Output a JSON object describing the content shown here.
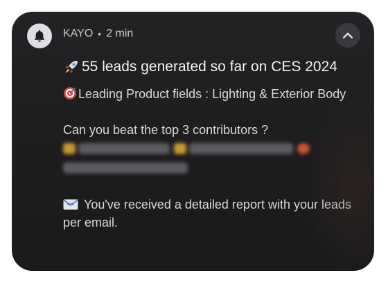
{
  "notification": {
    "app_name": "KAYO",
    "separator": "•",
    "time": "2 min",
    "title_emoji_icon": "rocket-emoji-icon",
    "title": "55 leads generated so far on CES 2024",
    "line1_emoji_icon": "target-emoji-icon",
    "line1": "Leading Product fields : Lighting & Exterior Body",
    "question": "Can you beat the top 3 contributors ?",
    "report_emoji_icon": "email-emoji-icon",
    "report": "You've received a detailed report with your leads per email."
  },
  "colors": {
    "card_bg": "#1f1e20",
    "app_icon_bg": "#dedee3",
    "text_primary": "#f4f3f5",
    "text_secondary": "#dad8db",
    "collapse_button_bg": "#393940"
  }
}
